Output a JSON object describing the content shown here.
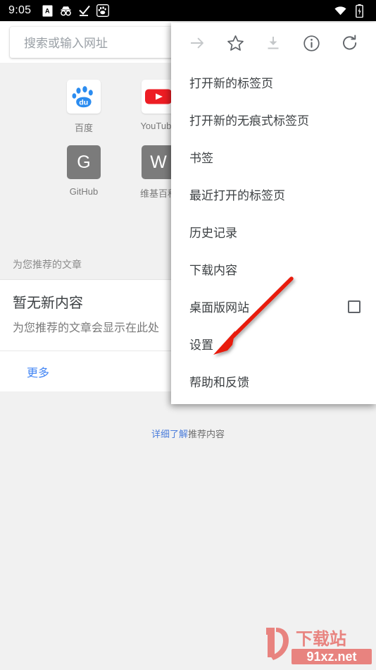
{
  "status_bar": {
    "time": "9:05",
    "left_icons": [
      {
        "name": "app-badge-icon"
      },
      {
        "name": "incognito-icon"
      },
      {
        "name": "checkmark-download-icon"
      },
      {
        "name": "baidu-paw-app-icon"
      }
    ],
    "right_icons": [
      {
        "name": "wifi-icon"
      },
      {
        "name": "battery-icon"
      }
    ]
  },
  "omnibox": {
    "placeholder": "搜索或输入网址",
    "value": "",
    "icon": "search-icon"
  },
  "tiles": [
    {
      "label": "百度",
      "icon": "baidu-paw-icon",
      "style": "image"
    },
    {
      "label": "YouTube",
      "icon": "youtube-play-icon",
      "style": "image"
    },
    {
      "label": "GitHub",
      "icon": "letter-g-icon",
      "letter": "G",
      "style": "gray"
    },
    {
      "label": "维基百科",
      "icon": "letter-w-icon",
      "letter": "W",
      "style": "gray"
    }
  ],
  "articles": {
    "section_header": "为您推荐的文章",
    "empty_title": "暂无新内容",
    "empty_subtitle": "为您推荐的文章会显示在此处",
    "more_label": "更多",
    "footer_link": "详细了解",
    "footer_rest": "推荐内容"
  },
  "menu": {
    "icon_row": [
      {
        "name": "forward-arrow-icon",
        "label": "前进",
        "state": "disabled"
      },
      {
        "name": "star-bookmark-icon",
        "label": "收藏",
        "state": "enabled"
      },
      {
        "name": "download-icon",
        "label": "下载",
        "state": "disabled"
      },
      {
        "name": "page-info-icon",
        "label": "网页信息",
        "state": "enabled"
      },
      {
        "name": "reload-icon",
        "label": "重新加载",
        "state": "enabled"
      }
    ],
    "items": [
      {
        "label": "打开新的标签页",
        "type": "item"
      },
      {
        "label": "打开新的无痕式标签页",
        "type": "item"
      },
      {
        "label": "书签",
        "type": "item"
      },
      {
        "label": "最近打开的标签页",
        "type": "item"
      },
      {
        "label": "历史记录",
        "type": "item"
      },
      {
        "label": "下载内容",
        "type": "item"
      },
      {
        "label": "桌面版网站",
        "type": "checkbox",
        "checked": false
      },
      {
        "label": "设置",
        "type": "item"
      },
      {
        "label": "帮助和反馈",
        "type": "item"
      }
    ]
  },
  "annotation": {
    "arrow_color": "#e81d0e",
    "points_to": "设置"
  },
  "watermark": {
    "title": "下载站",
    "mark": "91",
    "domain": "91xz.net",
    "color": "#e8837f"
  }
}
